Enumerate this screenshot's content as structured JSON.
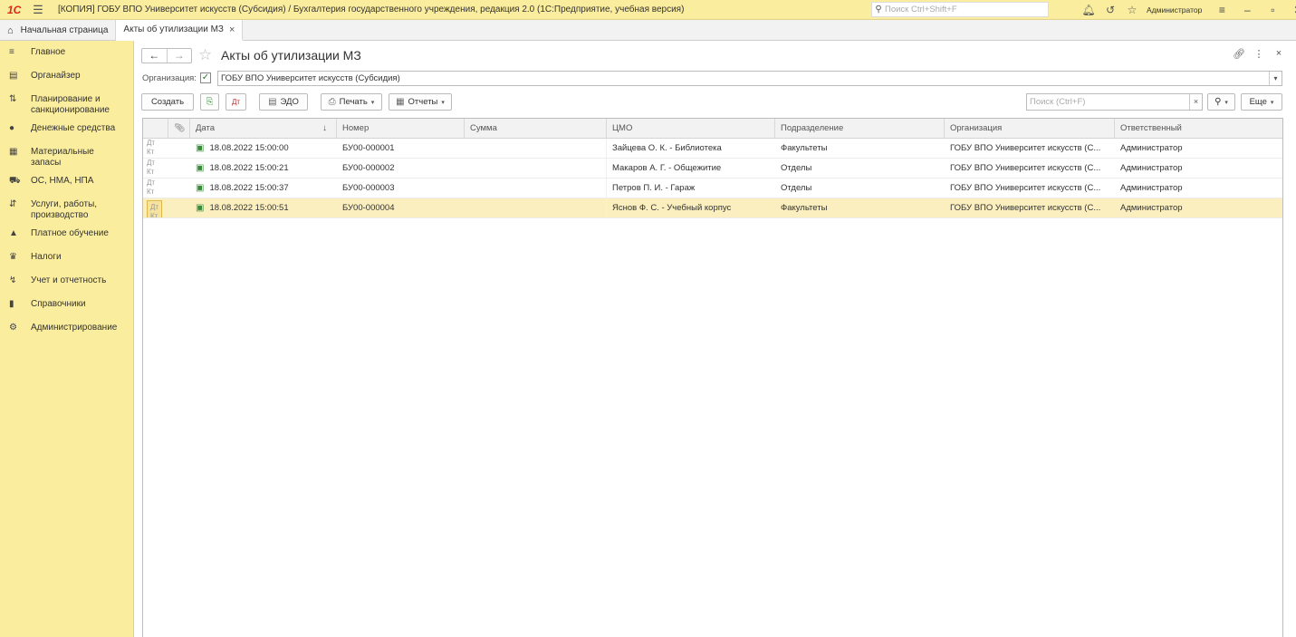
{
  "titlebar": {
    "logo": "1C",
    "title": "[КОПИЯ] ГОБУ ВПО Университет искусств (Субсидия) / Бухгалтерия государственного учреждения, редакция 2.0  (1С:Предприятие, учебная версия)",
    "search_placeholder": "Поиск Ctrl+Shift+F",
    "user": "Администратор"
  },
  "tabs": [
    {
      "label": "Начальная страница"
    },
    {
      "label": "Акты об утилизации МЗ"
    }
  ],
  "sidebar": {
    "items": [
      {
        "label": "Главное",
        "icon": "≡"
      },
      {
        "label": "Органайзер",
        "icon": "▤"
      },
      {
        "label": "Планирование и санкционирование",
        "icon": "⇅"
      },
      {
        "label": "Денежные средства",
        "icon": "●"
      },
      {
        "label": "Материальные запасы",
        "icon": "▦"
      },
      {
        "label": "ОС, НМА, НПА",
        "icon": "⛟"
      },
      {
        "label": "Услуги, работы, производство",
        "icon": "⇵"
      },
      {
        "label": "Платное обучение",
        "icon": "▲"
      },
      {
        "label": "Налоги",
        "icon": "♛"
      },
      {
        "label": "Учет и отчетность",
        "icon": "↯"
      },
      {
        "label": "Справочники",
        "icon": "▮"
      },
      {
        "label": "Администрирование",
        "icon": "⚙"
      }
    ]
  },
  "page": {
    "title": "Акты об утилизации МЗ",
    "org_label": "Организация:",
    "org_value": "ГОБУ ВПО Университет искусств (Субсидия)"
  },
  "toolbar": {
    "create": "Создать",
    "edo": "ЭДО",
    "print": "Печать",
    "reports": "Отчеты",
    "search_placeholder": "Поиск (Ctrl+F)",
    "more": "Еще"
  },
  "table": {
    "columns": {
      "date": "Дата",
      "number": "Номер",
      "sum": "Сумма",
      "cmo": "ЦМО",
      "department": "Подразделение",
      "organization": "Организация",
      "responsible": "Ответственный"
    },
    "rows": [
      {
        "date": "18.08.2022 15:00:00",
        "number": "БУ00-000001",
        "sum": "",
        "cmo": "Зайцева О. К. - Библиотека",
        "department": "Факультеты",
        "organization": "ГОБУ ВПО Университет искусств (С...",
        "responsible": "Администратор"
      },
      {
        "date": "18.08.2022 15:00:21",
        "number": "БУ00-000002",
        "sum": "",
        "cmo": "Макаров А. Г. - Общежитие",
        "department": "Отделы",
        "organization": "ГОБУ ВПО Университет искусств (С...",
        "responsible": "Администратор"
      },
      {
        "date": "18.08.2022 15:00:37",
        "number": "БУ00-000003",
        "sum": "",
        "cmo": "Петров П. И. - Гараж",
        "department": "Отделы",
        "organization": "ГОБУ ВПО Университет искусств (С...",
        "responsible": "Администратор"
      },
      {
        "date": "18.08.2022 15:00:51",
        "number": "БУ00-000004",
        "sum": "",
        "cmo": "Яснов Ф. С. - Учебный корпус",
        "department": "Факультеты",
        "organization": "ГОБУ ВПО Университет искусств (С...",
        "responsible": "Администратор"
      }
    ]
  },
  "colors": {
    "sidebar_bg": "#fbed9e",
    "selected_row": "#fbefbf",
    "logo_red": "#d8291b"
  }
}
